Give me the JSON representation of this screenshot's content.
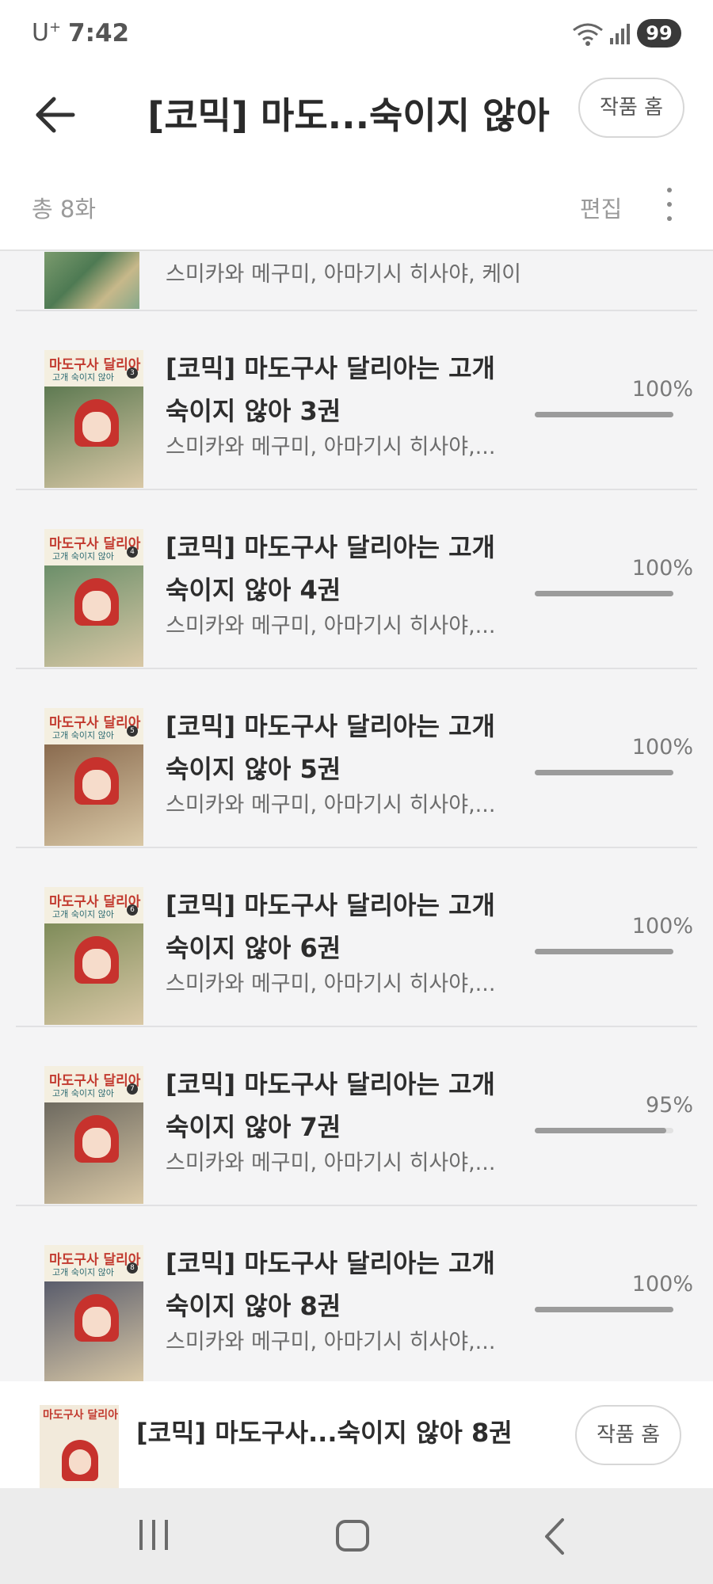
{
  "status_bar": {
    "carrier": "U",
    "carrier_sup": "+",
    "time": "7:42",
    "battery": "99",
    "icons": [
      "wifi-icon",
      "signal-icon"
    ]
  },
  "header": {
    "back_icon": "arrow-left-icon",
    "title": "[코믹] 마도...숙이지 않아",
    "home_button": "작품 홈"
  },
  "sub_header": {
    "total": "총 8화",
    "edit": "편집",
    "more_icon": "more-vertical-icon"
  },
  "list": {
    "partial_item": {
      "author": "스미카와 메구미, 아마기시 히사야, 케이"
    },
    "items": [
      {
        "title": "[코믹] 마도구사 달리아는 고개 숙이지 않아 3권",
        "author": "스미카와 메구미, 아마기시 히사야,...",
        "progress_text": "100%",
        "progress": 1.0,
        "cover_title": "마도구사 달리아",
        "cover_sub": "고개 숙이지 않아",
        "cover_volume": "3"
      },
      {
        "title": "[코믹] 마도구사 달리아는 고개 숙이지 않아 4권",
        "author": "스미카와 메구미, 아마기시 히사야,...",
        "progress_text": "100%",
        "progress": 1.0,
        "cover_title": "마도구사 달리아",
        "cover_sub": "고개 숙이지 않아",
        "cover_volume": "4"
      },
      {
        "title": "[코믹] 마도구사 달리아는 고개 숙이지 않아 5권",
        "author": "스미카와 메구미, 아마기시 히사야,...",
        "progress_text": "100%",
        "progress": 1.0,
        "cover_title": "마도구사 달리아",
        "cover_sub": "고개 숙이지 않아",
        "cover_volume": "5"
      },
      {
        "title": "[코믹] 마도구사 달리아는 고개 숙이지 않아 6권",
        "author": "스미카와 메구미, 아마기시 히사야,...",
        "progress_text": "100%",
        "progress": 1.0,
        "cover_title": "마도구사 달리아",
        "cover_sub": "고개 숙이지 않아",
        "cover_volume": "6"
      },
      {
        "title": "[코믹] 마도구사 달리아는 고개 숙이지 않아 7권",
        "author": "스미카와 메구미, 아마기시 히사야,...",
        "progress_text": "95%",
        "progress": 0.95,
        "cover_title": "마도구사 달리아",
        "cover_sub": "고개 숙이지 않아",
        "cover_volume": "7"
      },
      {
        "title": "[코믹] 마도구사 달리아는 고개 숙이지 않아 8권",
        "author": "스미카와 메구미, 아마기시 히사야,...",
        "progress_text": "100%",
        "progress": 1.0,
        "cover_title": "마도구사 달리아",
        "cover_sub": "고개 숙이지 않아",
        "cover_volume": "8"
      }
    ]
  },
  "mini_player": {
    "title": "[코믹] 마도구사...숙이지 않아 8권",
    "home_button": "작품 홈",
    "cover_title": "마도구사 달리아"
  },
  "nav_bar": {
    "icons": [
      "recents-icon",
      "home-icon",
      "back-icon"
    ]
  },
  "colors": {
    "background": "#f4f4f5",
    "progress_fill": "#9b9b9b",
    "progress_track": "#e2e2e2",
    "cover_hair": "#c7322d"
  }
}
